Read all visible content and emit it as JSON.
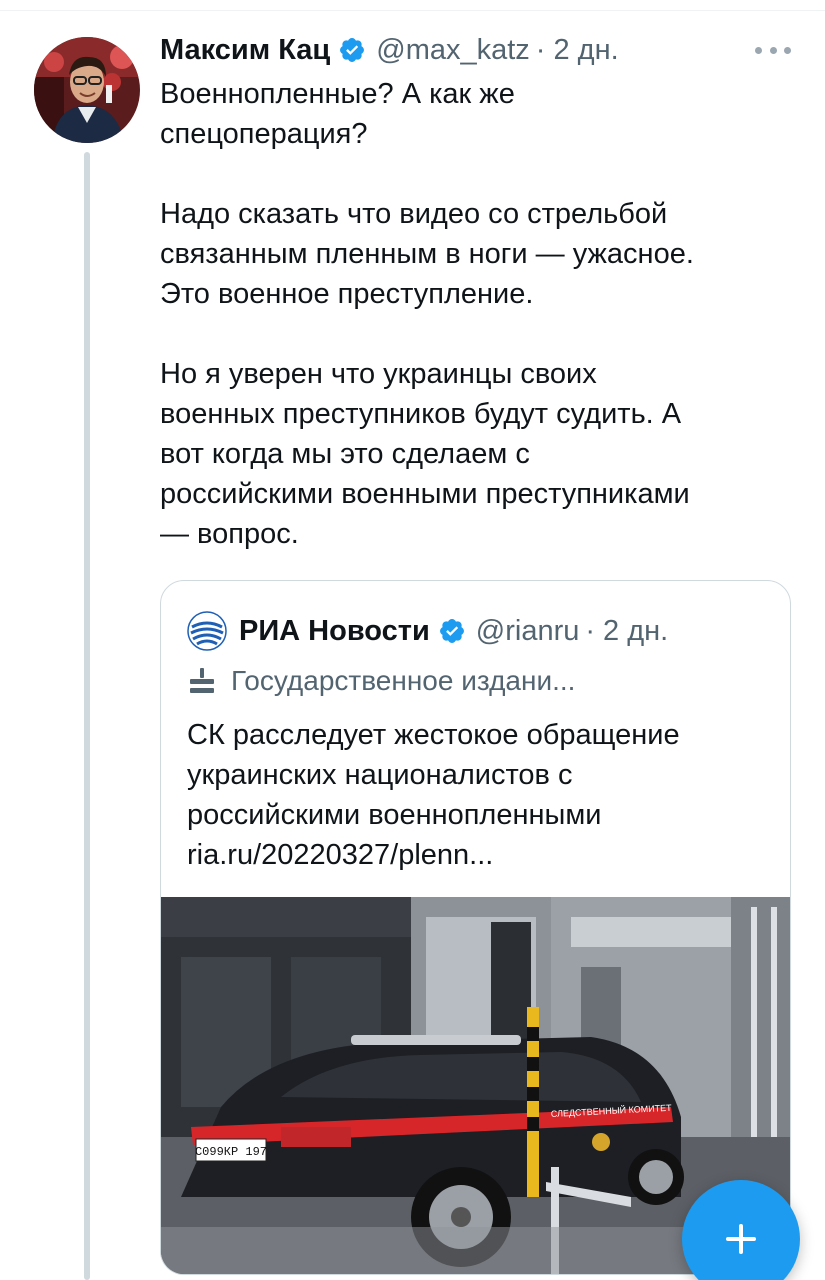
{
  "tweet": {
    "author_name": "Максим Кац",
    "handle": "@max_katz",
    "separator": "·",
    "time": "2 дн.",
    "paragraphs": [
      [
        "Военнопленные? А как же",
        "спецоперация?"
      ],
      [
        "Надо сказать что видео со стрельбой",
        "связанным пленным в ноги — ужасное.",
        "Это военное преступление."
      ],
      [
        "Но я уверен что украинцы своих",
        "военных преступников будут судить. А",
        "вот когда мы это сделаем с",
        "российскими военными преступниками",
        "— вопрос."
      ]
    ]
  },
  "quote": {
    "author_name": "РИА Новости",
    "handle": "@rianru",
    "separator": "·",
    "time": "2 дн.",
    "label": "Государственное издани...",
    "text_lines": [
      "СК расследует жестокое обращение",
      "украинских националистов с",
      "российскими военнопленными",
      "ria.ru/20220327/plenn..."
    ],
    "image": {
      "license_plate": "С099КР 197",
      "car_side_text": "СЛЕДСТВЕННЫЙ КОМИТЕТ"
    }
  },
  "icons": {
    "verified": "verified-badge-icon",
    "more": "more-icon",
    "compose": "compose-plus-icon",
    "building": "state-media-building-icon",
    "ria_logo": "ria-logo-icon"
  },
  "colors": {
    "accent": "#1d9bf0",
    "text": "#0f1419",
    "muted": "#536471",
    "border": "#cfd9de",
    "thread_line": "#cfd9de"
  }
}
